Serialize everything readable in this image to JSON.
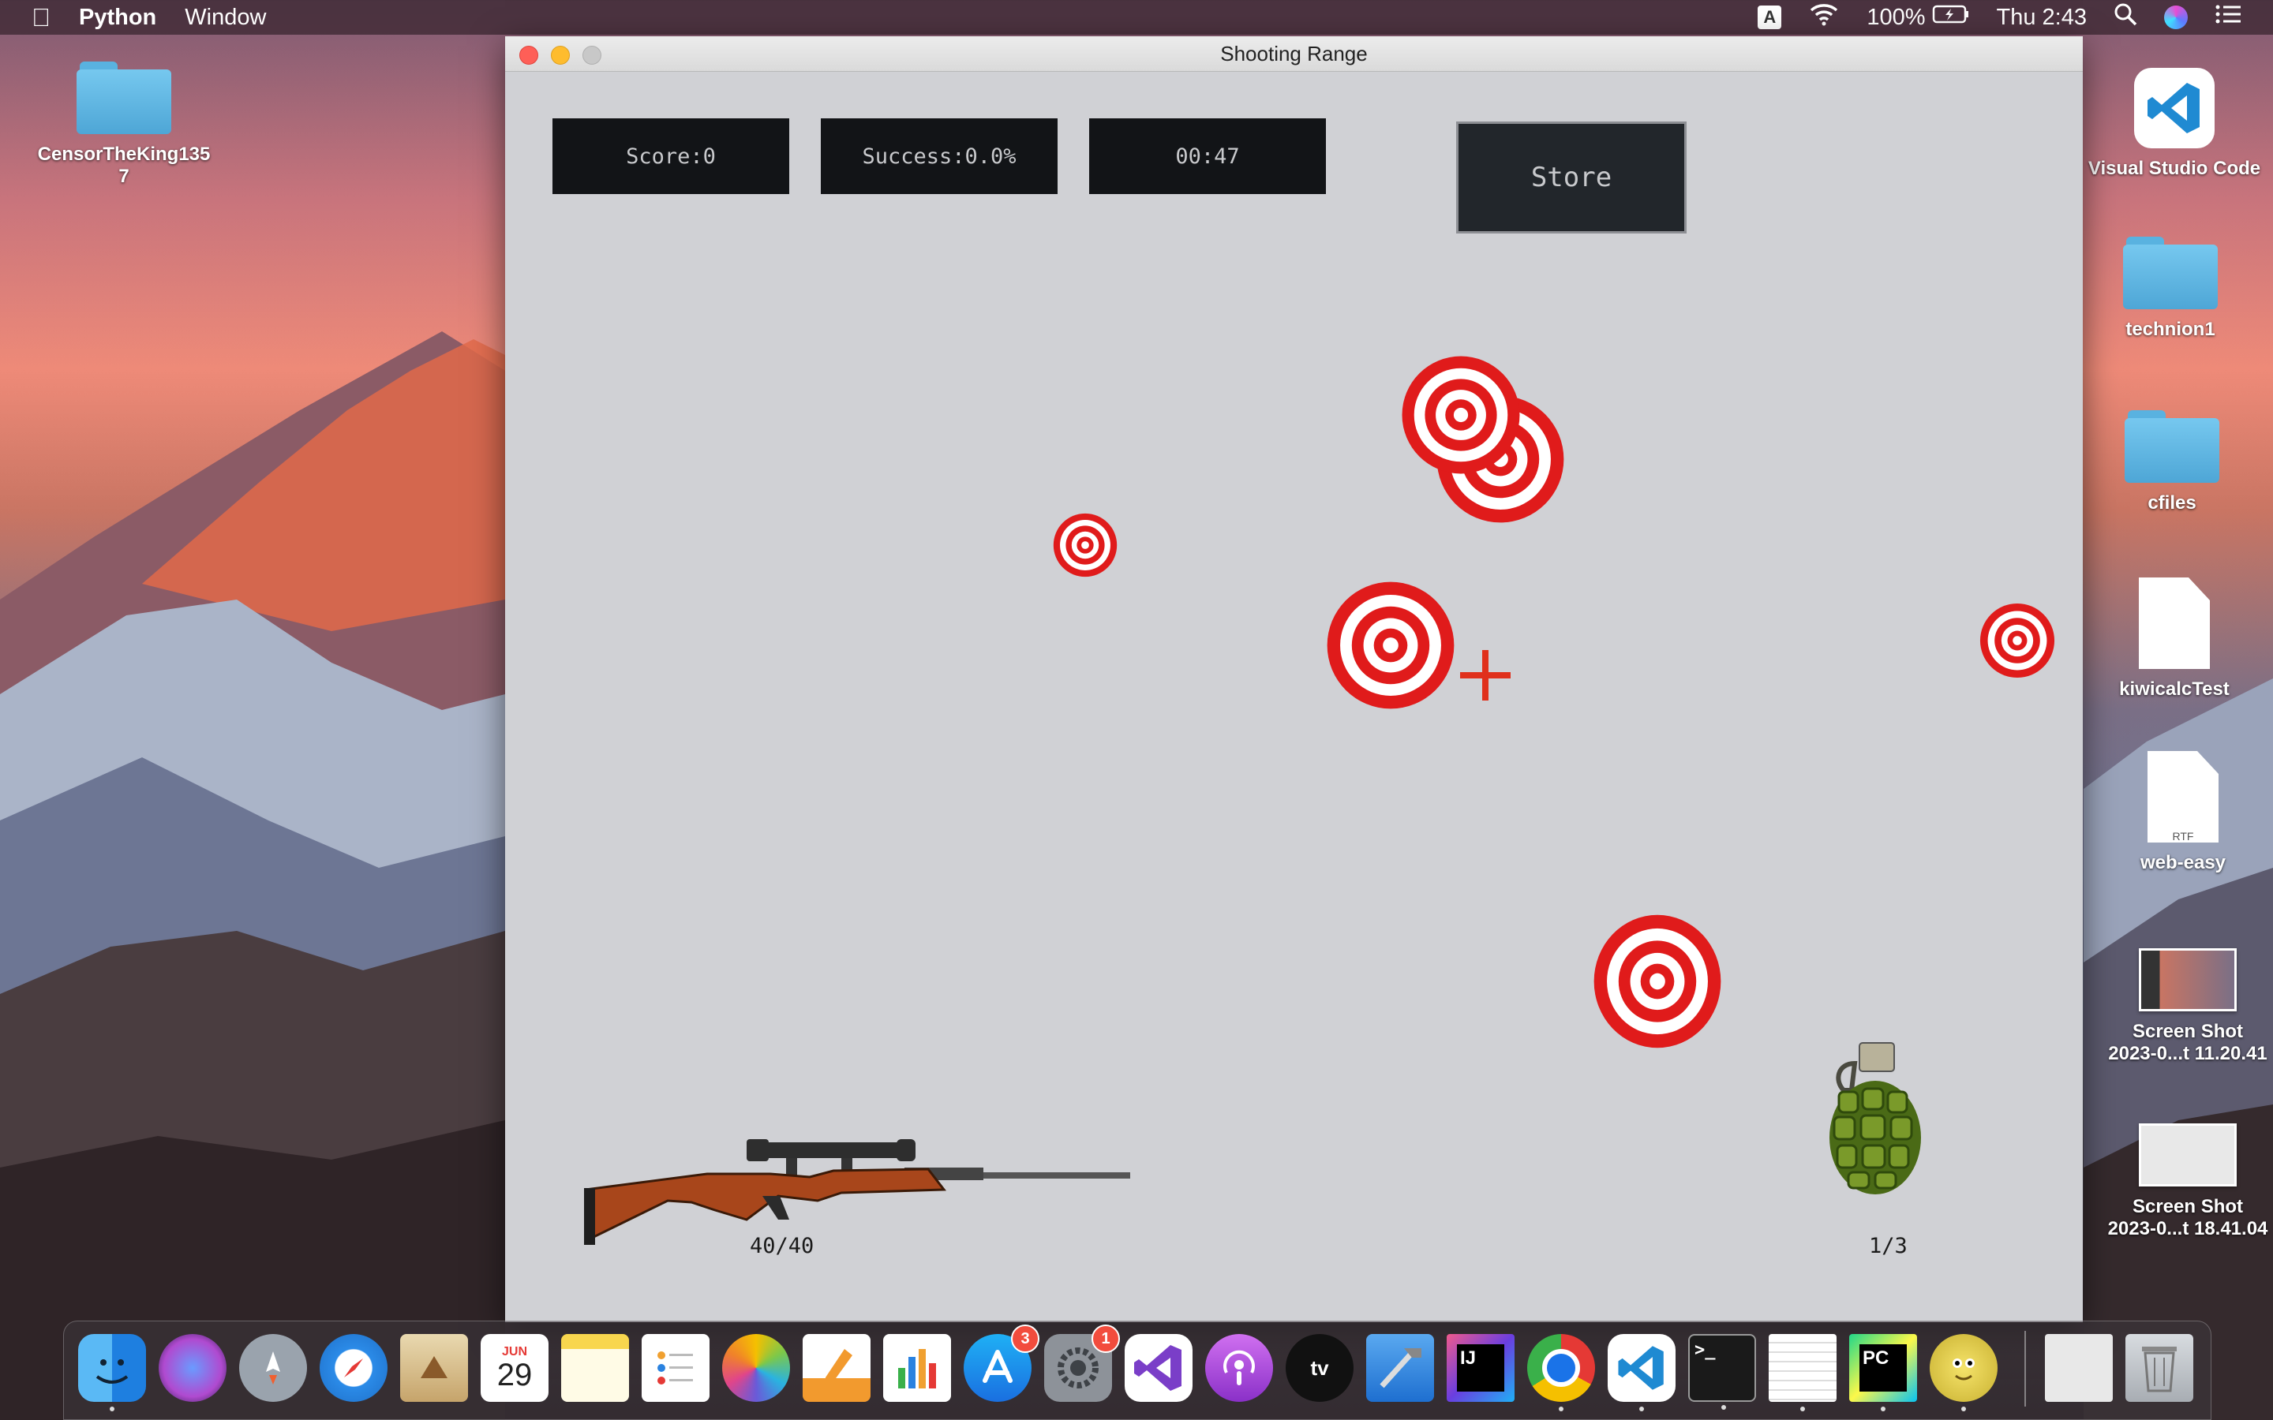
{
  "menubar": {
    "app_name": "Python",
    "menus": [
      "Window"
    ],
    "input_badge": "A",
    "battery": "100%",
    "clock": "Thu 2:43"
  },
  "desktop": {
    "left_icons": [
      {
        "label": "CensorTheKing135\n7",
        "kind": "folder"
      }
    ],
    "right_icons": [
      {
        "label": "Visual Studio Code",
        "kind": "app"
      },
      {
        "label": "technion1",
        "kind": "folder"
      },
      {
        "label": "cfiles",
        "kind": "folder"
      },
      {
        "label": "kiwicalcTest",
        "kind": "document"
      },
      {
        "label": "web-easy",
        "kind": "rtf-document"
      },
      {
        "label": "Screen Shot\n2023-0...t 11.20.41",
        "kind": "screenshot"
      },
      {
        "label": "Screen Shot\n2023-0...t 18.41.04",
        "kind": "screenshot"
      }
    ]
  },
  "window": {
    "title": "Shooting Range",
    "hud": {
      "score": "Score:0",
      "success": "Success:0.0%",
      "timer": "00:47"
    },
    "store_label": "Store",
    "rifle_ammo": "40/40",
    "grenades": "1/3",
    "colors": {
      "target_red": "#e01b1b",
      "crosshair": "#e0301b",
      "hud_bg": "#121417",
      "canvas_bg": "#d0d1d5"
    }
  },
  "dock": {
    "apps": [
      {
        "name": "finder-icon",
        "running": true
      },
      {
        "name": "siri-icon",
        "running": false
      },
      {
        "name": "launchpad-icon",
        "running": false
      },
      {
        "name": "safari-icon",
        "running": false
      },
      {
        "name": "mail-icon",
        "running": false
      },
      {
        "name": "calendar-icon",
        "running": false,
        "month": "JUN",
        "day": "29"
      },
      {
        "name": "notes-icon",
        "running": false
      },
      {
        "name": "reminders-icon",
        "running": false
      },
      {
        "name": "photos-icon",
        "running": false
      },
      {
        "name": "pages-icon",
        "running": false
      },
      {
        "name": "numbers-icon",
        "running": false
      },
      {
        "name": "app-store-icon",
        "running": false,
        "badge": "3"
      },
      {
        "name": "system-preferences-icon",
        "running": false,
        "badge": "1"
      },
      {
        "name": "visual-studio-icon",
        "running": false
      },
      {
        "name": "podcasts-icon",
        "running": false
      },
      {
        "name": "apple-tv-icon",
        "running": false,
        "text": "tv"
      },
      {
        "name": "xcode-icon",
        "running": false
      },
      {
        "name": "intellij-icon",
        "running": false,
        "text": "IJ"
      },
      {
        "name": "chrome-icon",
        "running": true
      },
      {
        "name": "vscode-icon",
        "running": true
      },
      {
        "name": "terminal-icon",
        "running": true,
        "text": ">_"
      },
      {
        "name": "textedit-icon",
        "running": true
      },
      {
        "name": "pycharm-icon",
        "running": true,
        "text": "PC"
      },
      {
        "name": "python-launcher-icon",
        "running": true
      },
      {
        "name": "downloads-stack-icon",
        "running": false
      },
      {
        "name": "trash-icon",
        "running": false
      }
    ]
  }
}
